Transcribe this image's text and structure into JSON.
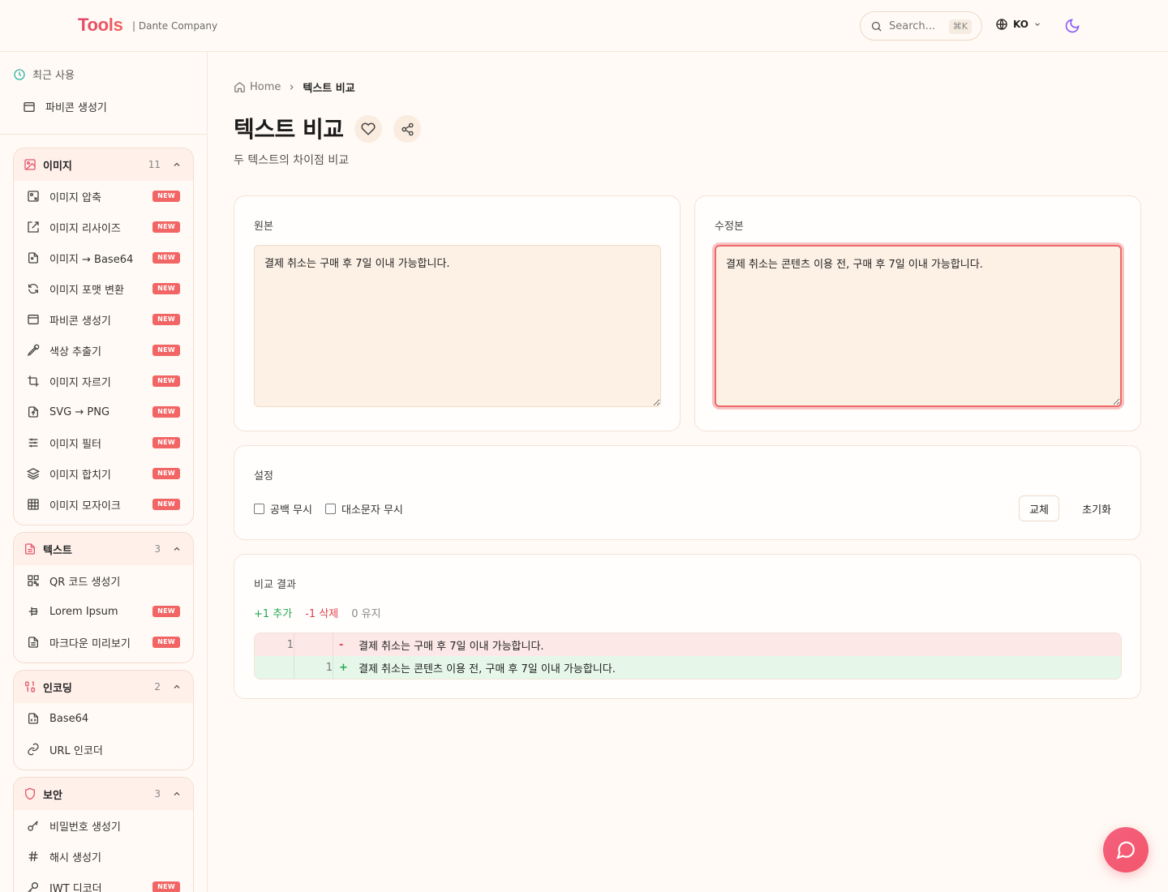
{
  "header": {
    "logo": "Tools",
    "company": "| Dante Company",
    "search_placeholder": "Search...",
    "search_shortcut": "⌘K",
    "lang": "KO"
  },
  "sidebar": {
    "recent_label": "최근 사용",
    "recent_item": "파비콘 생성기",
    "groups": {
      "image": {
        "title": "이미지",
        "count": "11",
        "items": [
          "이미지 압축",
          "이미지 리사이즈",
          "이미지 → Base64",
          "이미지 포맷 변환",
          "파비콘 생성기",
          "색상 추출기",
          "이미지 자르기",
          "SVG → PNG",
          "이미지 필터",
          "이미지 합치기",
          "이미지 모자이크"
        ]
      },
      "text": {
        "title": "텍스트",
        "count": "3",
        "items": [
          "QR 코드 생성기",
          "Lorem Ipsum",
          "마크다운 미리보기"
        ]
      },
      "encoding": {
        "title": "인코딩",
        "count": "2",
        "items": [
          "Base64",
          "URL 인코더"
        ]
      },
      "security": {
        "title": "보안",
        "count": "3",
        "items": [
          "비밀번호 생성기",
          "해시 생성기",
          "JWT 디코더"
        ]
      }
    },
    "new_badge": "NEW"
  },
  "breadcrumb": {
    "home": "Home",
    "current": "텍스트 비교"
  },
  "page": {
    "title": "텍스트 비교",
    "subtitle": "두 텍스트의 차이점 비교"
  },
  "original": {
    "label": "원본",
    "value": "결제 취소는 구매 후 7일 이내 가능합니다."
  },
  "modified": {
    "label": "수정본",
    "value": "결제 취소는 콘텐츠 이용 전, 구매 후 7일 이내 가능합니다."
  },
  "settings": {
    "label": "설정",
    "ignore_whitespace": "공백 무시",
    "ignore_case": "대소문자 무시",
    "swap": "교체",
    "reset": "초기화"
  },
  "result": {
    "label": "비교 결과",
    "added": "+1 추가",
    "removed": "-1 삭제",
    "kept": "0 유지",
    "rows": [
      {
        "old_no": "1",
        "new_no": "",
        "sign": "-",
        "text": "결제 취소는 구매 후 7일 이내 가능합니다."
      },
      {
        "old_no": "",
        "new_no": "1",
        "sign": "+",
        "text": "결제 취소는 콘텐츠 이용 전, 구매 후 7일 이내 가능합니다."
      }
    ]
  },
  "colors": {
    "accent": "#f26565",
    "added": "#22a851",
    "removed": "#e2424f"
  }
}
